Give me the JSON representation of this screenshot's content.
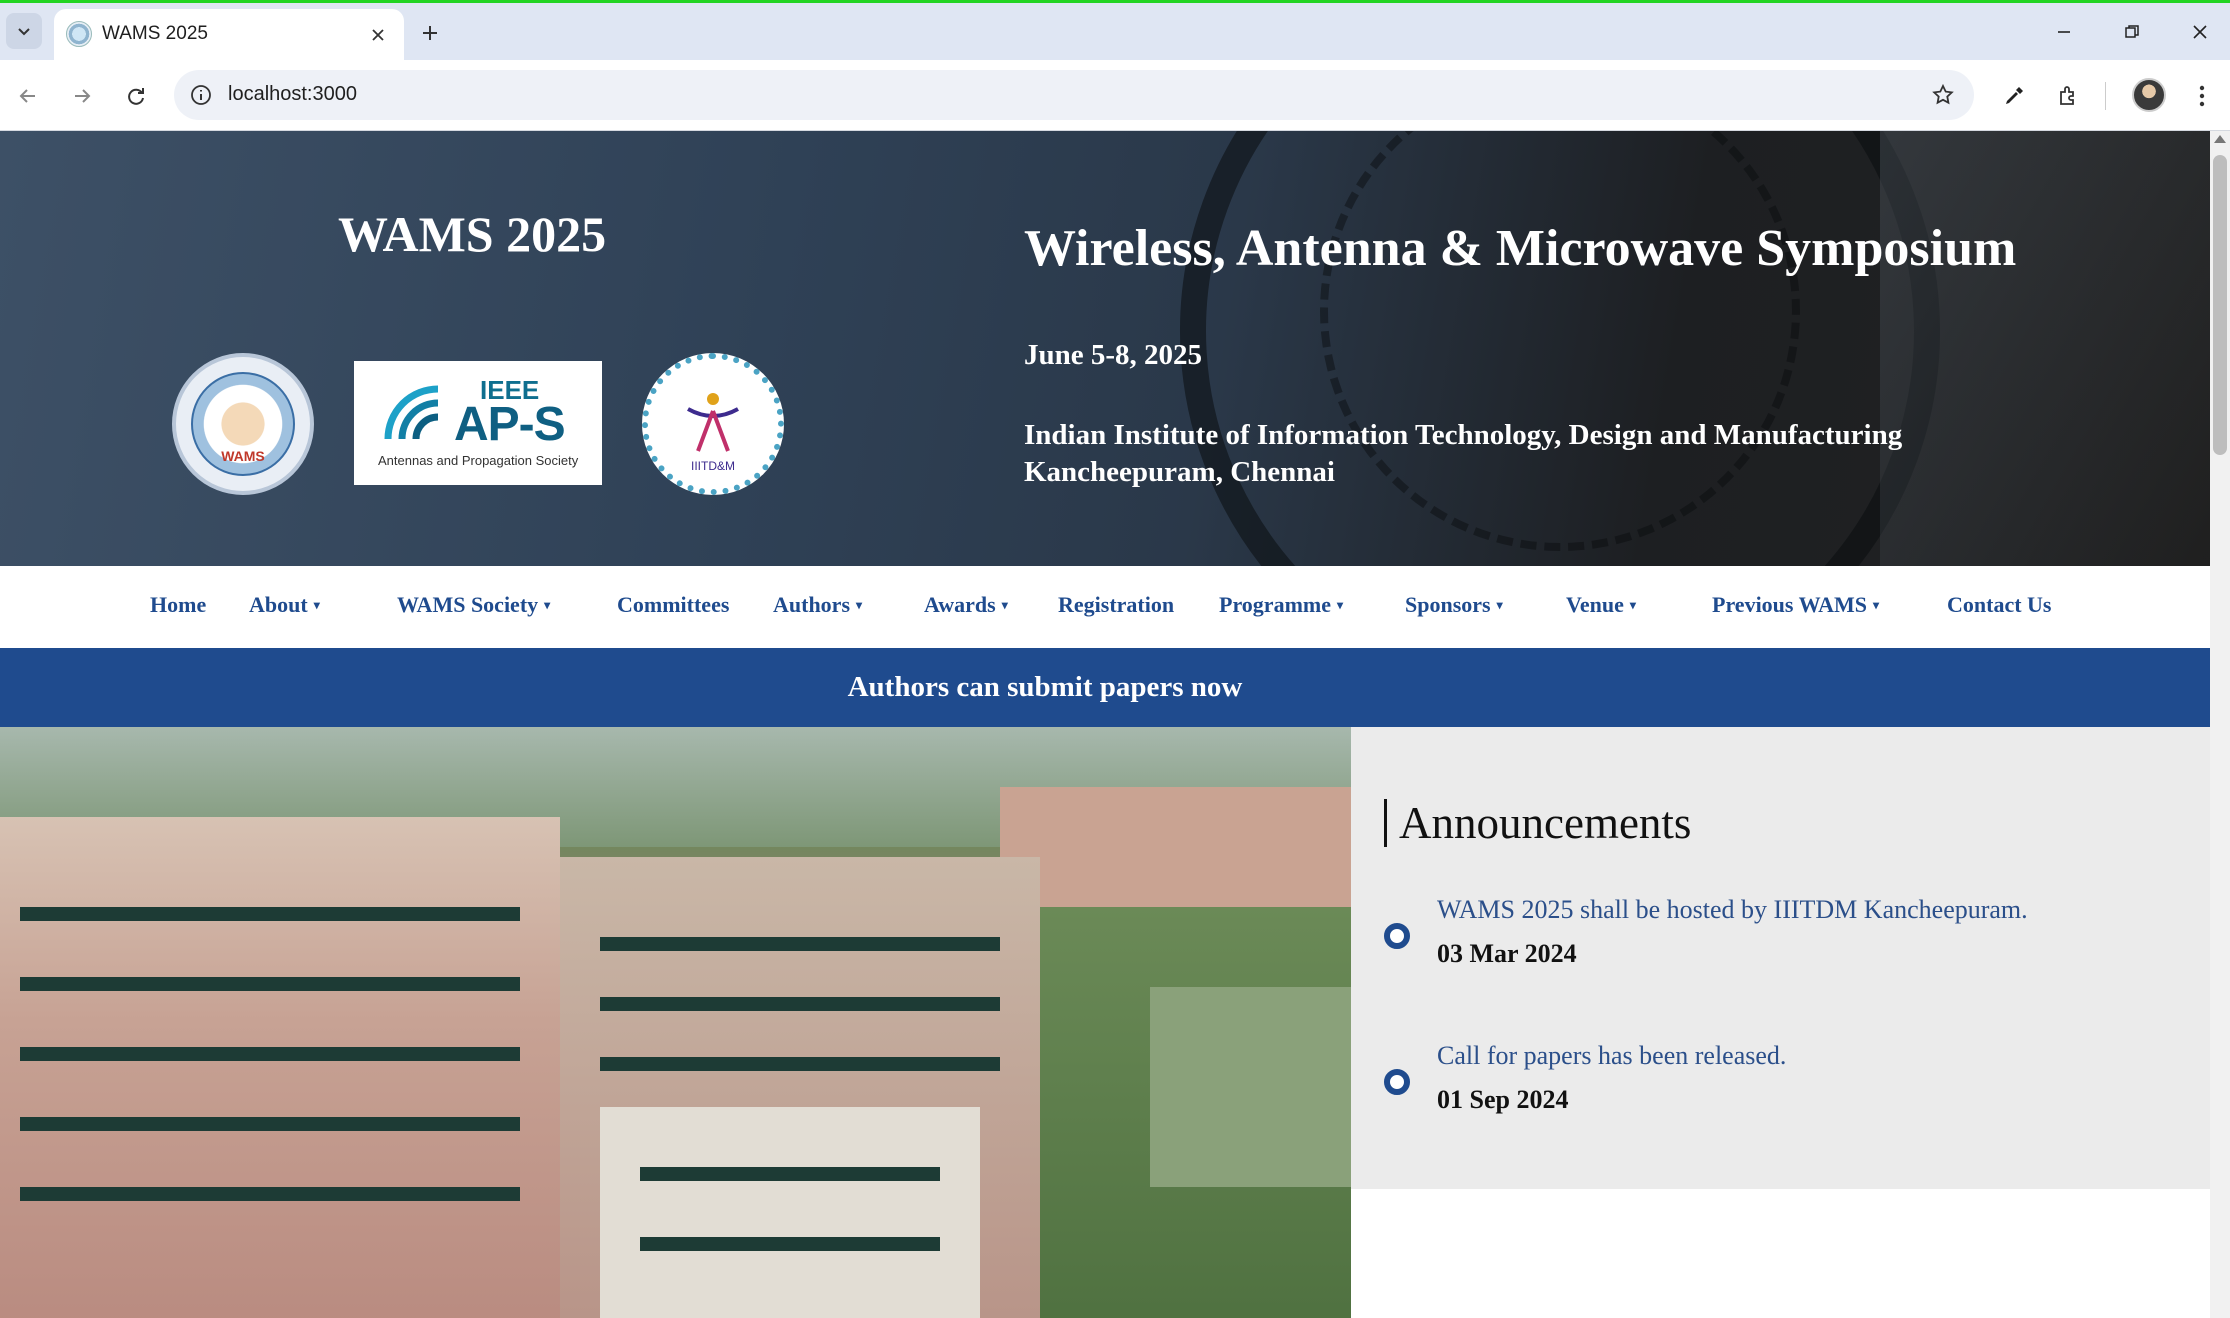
{
  "browser": {
    "tab_title": "WAMS 2025",
    "url": "localhost:3000"
  },
  "hero": {
    "short_title": "WAMS 2025",
    "full_title": "Wireless, Antenna & Microwave Symposium",
    "dates": "June 5-8, 2025",
    "venue_line1": "Indian Institute of Information Technology, Design and Manufacturing",
    "venue_line2": "Kancheepuram, Chennai",
    "logos": {
      "wams": "WAMS",
      "ieee": "IEEE",
      "aps": "AP-S",
      "aps_sub": "Antennas and Propagation Society",
      "iiitdm": "IIITD&M"
    }
  },
  "nav": {
    "items": [
      {
        "label": "Home",
        "dropdown": false
      },
      {
        "label": "About",
        "dropdown": true
      },
      {
        "label": "WAMS Society",
        "dropdown": true
      },
      {
        "label": "Committees",
        "dropdown": false
      },
      {
        "label": "Authors",
        "dropdown": true
      },
      {
        "label": "Awards",
        "dropdown": true
      },
      {
        "label": "Registration",
        "dropdown": false
      },
      {
        "label": "Programme",
        "dropdown": true
      },
      {
        "label": "Sponsors",
        "dropdown": true
      },
      {
        "label": "Venue",
        "dropdown": true
      },
      {
        "label": "Previous WAMS",
        "dropdown": true
      },
      {
        "label": "Contact Us",
        "dropdown": false
      }
    ],
    "caret": "▾"
  },
  "banner": {
    "text": "Authors can submit papers now"
  },
  "announcements": {
    "title": "Announcements",
    "items": [
      {
        "text": "WAMS 2025 shall be hosted by IIITDM Kancheepuram.",
        "date": "03 Mar 2024"
      },
      {
        "text": "Call for papers has been released.",
        "date": "01 Sep 2024"
      }
    ]
  },
  "colors": {
    "primary": "#1f4b8e",
    "announcement_bg": "#ebebeb"
  }
}
